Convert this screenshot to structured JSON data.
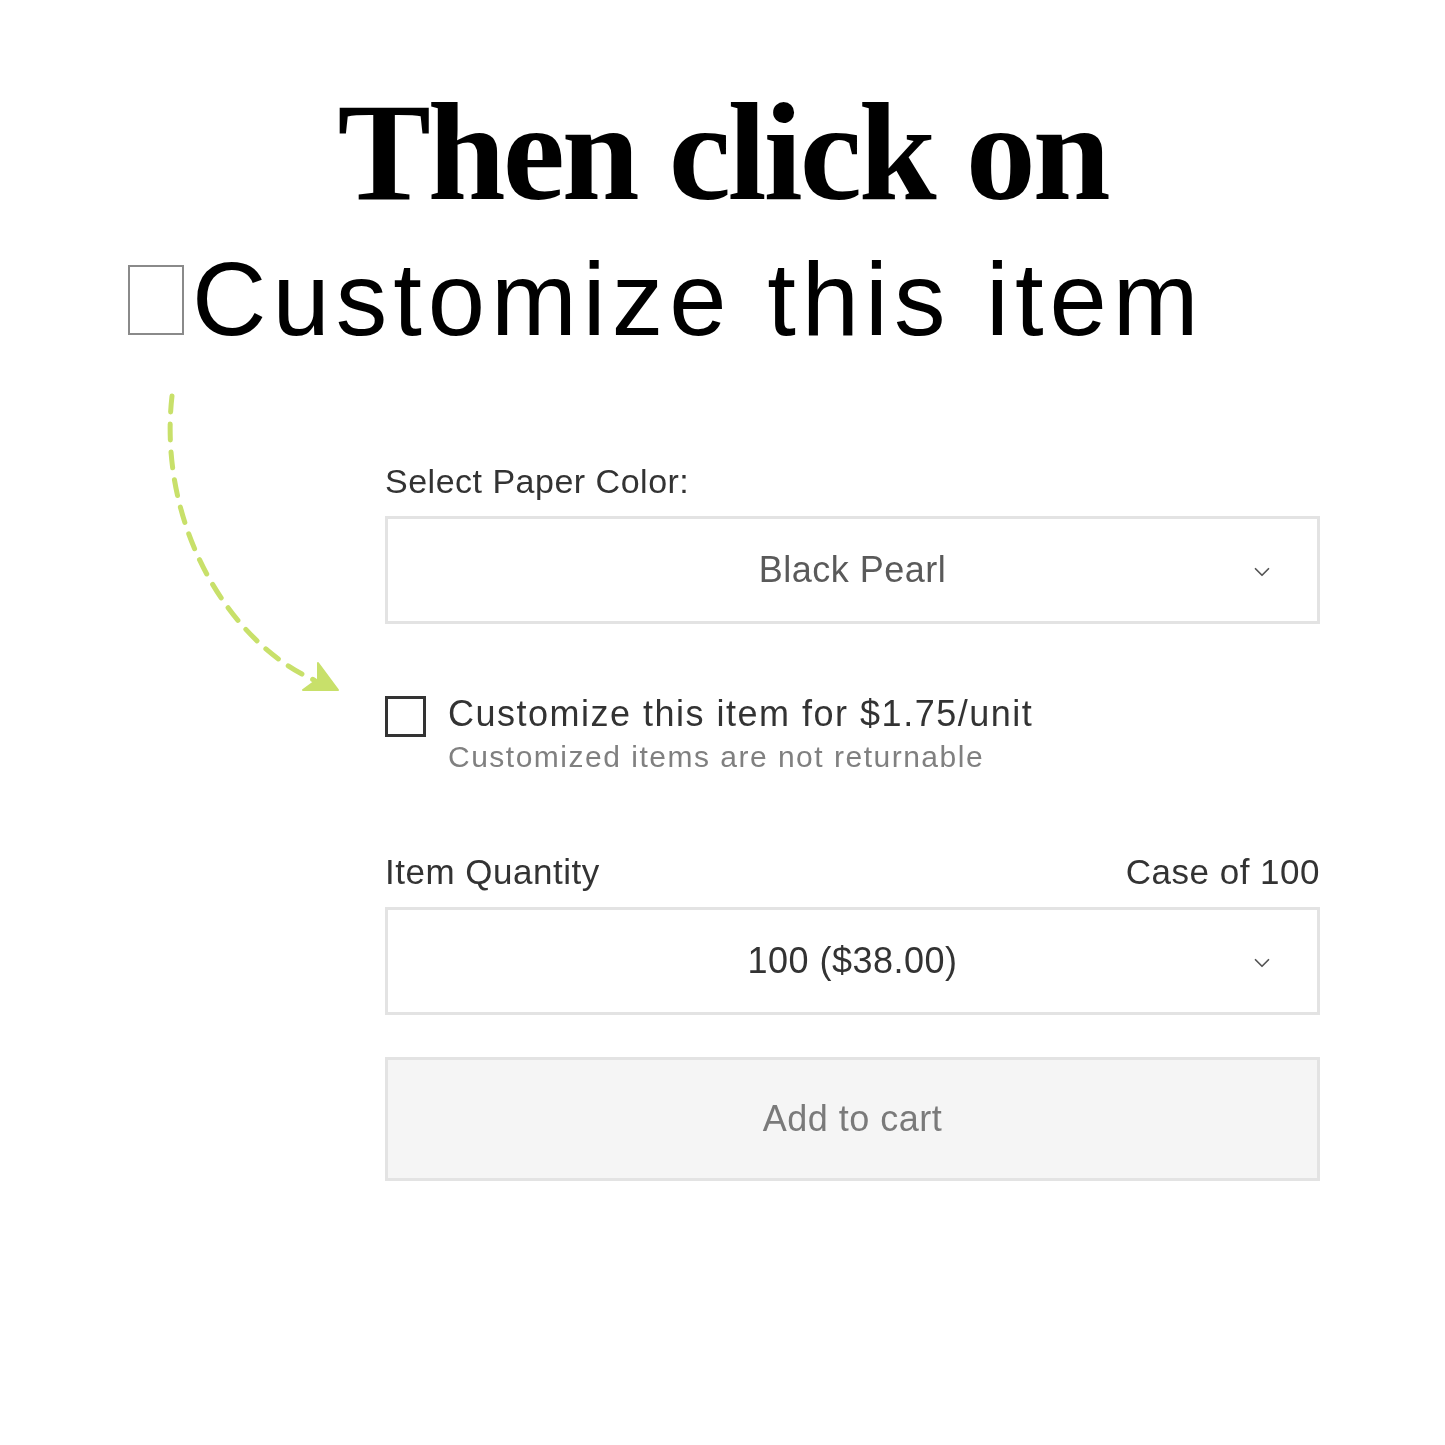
{
  "heading": "Then click on",
  "subheading": {
    "text": "Customize this item"
  },
  "form": {
    "paper_color": {
      "label": "Select Paper Color:",
      "value": "Black Pearl"
    },
    "customize": {
      "label": "Customize this item for $1.75/unit",
      "note": "Customized items are not returnable",
      "checked": false
    },
    "quantity": {
      "label": "Item Quantity",
      "hint": "Case of 100",
      "value": "100 ($38.00)"
    },
    "add_to_cart": {
      "label": "Add to cart",
      "disabled": true
    }
  }
}
